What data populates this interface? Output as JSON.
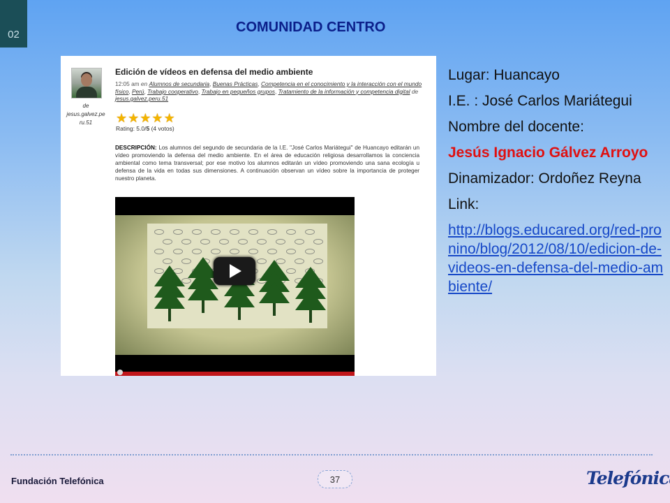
{
  "slide": {
    "number": "02",
    "title": "COMUNIDAD CENTRO",
    "page": "37"
  },
  "post": {
    "author_prefix": "de",
    "author": "jesus.galvez.peru.51",
    "title": "Edición de vídeos en defensa del medio ambiente",
    "time": "12:05 am",
    "time_in": "en",
    "categories": [
      "Alumnos de secundaria",
      "Buenas Prácticas",
      "Competencia en el conocimiento y la interacción con el mundo físico",
      "Perú",
      "Trabajo cooperativo",
      "Trabajo en pequeños grupos",
      "Tratamiento de la información y competencia digital"
    ],
    "by_prefix": "de",
    "by": "jesus.galvez.peru.51",
    "stars": 5,
    "rating_label": "Rating: 5.0/",
    "rating_max": "5",
    "rating_votes": "(4 votos)",
    "description_label": "DESCRIPCIÓN:",
    "description": "Los alumnos del segundo de secundaria de la I.E. \"José Carlos Mariátegui\" de Huancayo editarán un vídeo promoviendo la defensa del medio ambiente. En el área de educación religiosa desarrollamos la conciencia ambiental como tema transversal; por ese motivo los alumnos editarán un vídeo promoviendo una sana ecología u defensa de la vida en todas sus dimensiones. A continuación observan un vídeo sobre la importancia de proteger nuestro planeta."
  },
  "info": {
    "lugar": "Lugar: Huancayo",
    "ie": "I.E. : José Carlos Mariátegui",
    "docente_label": "Nombre del docente:",
    "docente": "Jesús Ignacio Gálvez Arroyo",
    "dinamizador": "Dinamizador: Ordoñez Reyna",
    "link_label": "Link:",
    "link": "http://blogs.educared.org/red-pronino/blog/2012/08/10/edicion-de-videos-en-defensa-del-medio-ambiente/"
  },
  "footer": {
    "org": "Fundación Telefónica",
    "logo_text": "Telefonica"
  },
  "colors": {
    "title": "#0b1f8a",
    "teacher": "#e01010",
    "link": "#1648c8",
    "slide_tab": "#1b4e57"
  }
}
